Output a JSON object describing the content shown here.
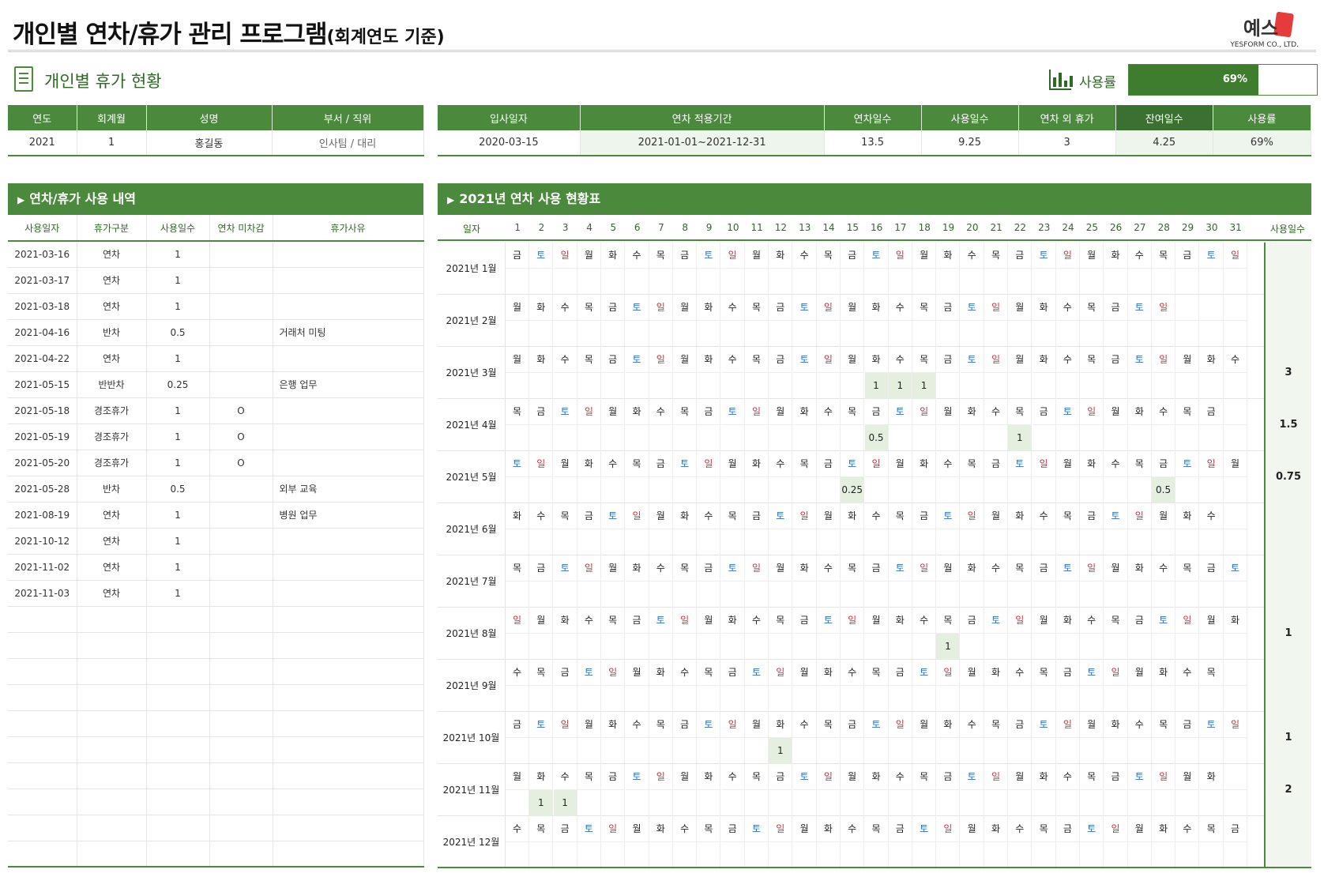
{
  "title": {
    "main": "개인별 연차/휴가 관리 프로그램",
    "sub": "(회계연도 기준)"
  },
  "logo": {
    "ko": "예스",
    "en": "YESFORM CO., LTD."
  },
  "section": {
    "title": "개인별 휴가 현황"
  },
  "usage": {
    "label": "사용률",
    "value": "69%",
    "fraction": 0.69
  },
  "info_left": {
    "headers": [
      "연도",
      "회계월",
      "성명",
      "부서 / 직위"
    ],
    "values": [
      "2021",
      "1",
      "홍길동",
      "인사팀 / 대리"
    ]
  },
  "info_right": {
    "headers": [
      "입사일자",
      "연차 적용기간",
      "연차일수",
      "사용일수",
      "연차 외 휴가",
      "잔여일수",
      "사용률"
    ],
    "values": [
      "2020-03-15",
      "2021-01-01~2021-12-31",
      "13.5",
      "9.25",
      "3",
      "4.25",
      "69%"
    ]
  },
  "history": {
    "title": "연차/휴가 사용 내역",
    "headers": [
      "사용일자",
      "휴가구분",
      "사용일수",
      "연차 미차감",
      "휴가사유"
    ],
    "rows": [
      [
        "2021-03-16",
        "연차",
        "1",
        "",
        ""
      ],
      [
        "2021-03-17",
        "연차",
        "1",
        "",
        ""
      ],
      [
        "2021-03-18",
        "연차",
        "1",
        "",
        ""
      ],
      [
        "2021-04-16",
        "반차",
        "0.5",
        "",
        "거래처 미팅"
      ],
      [
        "2021-04-22",
        "연차",
        "1",
        "",
        ""
      ],
      [
        "2021-05-15",
        "반반차",
        "0.25",
        "",
        "은행 업무"
      ],
      [
        "2021-05-18",
        "경조휴가",
        "1",
        "O",
        ""
      ],
      [
        "2021-05-19",
        "경조휴가",
        "1",
        "O",
        ""
      ],
      [
        "2021-05-20",
        "경조휴가",
        "1",
        "O",
        ""
      ],
      [
        "2021-05-28",
        "반차",
        "0.5",
        "",
        "외부 교육"
      ],
      [
        "2021-08-19",
        "연차",
        "1",
        "",
        "병원 업무"
      ],
      [
        "2021-10-12",
        "연차",
        "1",
        "",
        ""
      ],
      [
        "2021-11-02",
        "연차",
        "1",
        "",
        ""
      ],
      [
        "2021-11-03",
        "연차",
        "1",
        "",
        ""
      ],
      [
        "",
        "",
        "",
        "",
        ""
      ],
      [
        "",
        "",
        "",
        "",
        ""
      ],
      [
        "",
        "",
        "",
        "",
        ""
      ],
      [
        "",
        "",
        "",
        "",
        ""
      ],
      [
        "",
        "",
        "",
        "",
        ""
      ],
      [
        "",
        "",
        "",
        "",
        ""
      ],
      [
        "",
        "",
        "",
        "",
        ""
      ],
      [
        "",
        "",
        "",
        "",
        ""
      ],
      [
        "",
        "",
        "",
        "",
        ""
      ],
      [
        "",
        "",
        "",
        "",
        ""
      ]
    ]
  },
  "calendar": {
    "title": "2021년 연차 사용 현황표",
    "col_label": "일자",
    "days": [
      "1",
      "2",
      "3",
      "4",
      "5",
      "6",
      "7",
      "8",
      "9",
      "10",
      "11",
      "12",
      "13",
      "14",
      "15",
      "16",
      "17",
      "18",
      "19",
      "20",
      "21",
      "22",
      "23",
      "24",
      "25",
      "26",
      "27",
      "28",
      "29",
      "30",
      "31"
    ],
    "total_label": "사용일수",
    "weekday_names": [
      "월",
      "화",
      "수",
      "목",
      "금",
      "토",
      "일"
    ],
    "months": [
      {
        "label": "2021년 1월",
        "days_in_month": 31,
        "first_weekday": 4,
        "usage": {},
        "total": ""
      },
      {
        "label": "2021년 2월",
        "days_in_month": 28,
        "first_weekday": 0,
        "usage": {},
        "total": ""
      },
      {
        "label": "2021년 3월",
        "days_in_month": 31,
        "first_weekday": 0,
        "usage": {
          "16": "1",
          "17": "1",
          "18": "1"
        },
        "total": "3"
      },
      {
        "label": "2021년 4월",
        "days_in_month": 30,
        "first_weekday": 3,
        "usage": {
          "16": "0.5",
          "22": "1"
        },
        "total": "1.5"
      },
      {
        "label": "2021년 5월",
        "days_in_month": 31,
        "first_weekday": 5,
        "usage": {
          "15": "0.25",
          "28": "0.5"
        },
        "total": "0.75"
      },
      {
        "label": "2021년 6월",
        "days_in_month": 30,
        "first_weekday": 1,
        "usage": {},
        "total": ""
      },
      {
        "label": "2021년 7월",
        "days_in_month": 31,
        "first_weekday": 3,
        "usage": {},
        "total": ""
      },
      {
        "label": "2021년 8월",
        "days_in_month": 31,
        "first_weekday": 6,
        "usage": {
          "19": "1"
        },
        "total": "1"
      },
      {
        "label": "2021년 9월",
        "days_in_month": 30,
        "first_weekday": 2,
        "usage": {},
        "total": ""
      },
      {
        "label": "2021년 10월",
        "days_in_month": 31,
        "first_weekday": 4,
        "usage": {
          "12": "1"
        },
        "total": "1"
      },
      {
        "label": "2021년 11월",
        "days_in_month": 30,
        "first_weekday": 0,
        "usage": {
          "2": "1",
          "3": "1"
        },
        "total": "2"
      },
      {
        "label": "2021년 12월",
        "days_in_month": 31,
        "first_weekday": 2,
        "usage": {},
        "total": ""
      }
    ]
  },
  "colors": {
    "accent": "#4b8a3c",
    "saturday": "#2a6fd0",
    "sunday": "#d2333f",
    "used_cell": "#e4efe0"
  }
}
